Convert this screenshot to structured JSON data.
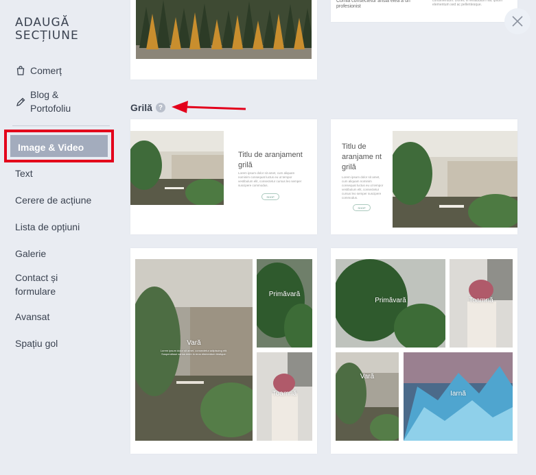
{
  "sidebar": {
    "title": "ADAUGĂ SECȚIUNE",
    "items": [
      {
        "label": "Comerț",
        "icon": "bag-icon"
      },
      {
        "label": "Blog & Portofoliu",
        "icon": "edit-icon"
      },
      {
        "label": "Image & Video"
      },
      {
        "label": "Text"
      },
      {
        "label": "Cerere de acțiune"
      },
      {
        "label": "Lista de opțiuni"
      },
      {
        "label": "Galerie"
      },
      {
        "label": "Contact și formulare"
      },
      {
        "label": "Avansat"
      },
      {
        "label": "Spațiu gol"
      }
    ]
  },
  "main": {
    "top_card_text_left": "Comia consectetur ansia elea a un profesionist",
    "top_card_text_right": "condimentum. Donec in vestibulum hac ipsum elementum sed ac pellentesque.",
    "section_label": "Grilă",
    "grid_card_1": {
      "title": "Titlu de aranjament grilă",
      "body": "Lorem ipsum dolor sit amet, cum aliquam nominim consequat luctus eu ut tempor vestibulum elit, consectetur cursus leo semper suscipere commodus.",
      "button": "SHOP"
    },
    "grid_card_2": {
      "title": "Titlu de aranjame nt grilă",
      "body": "Lorem ipsum dolor sit amet, cum aliquam nominim consequat luctus eu ut tempor vestibulum elit, consectetur cursus leo semper suscipere commodus.",
      "button": "SHOP"
    },
    "seasons_left": {
      "big": "Vară",
      "big_caption": "Lorem ipsum dolor sit amet, consectetur adipiscing elit. Suspendisse varius enim in eros elementum tristique.",
      "top_right": "Primăvară",
      "bottom_right": "Toamnă"
    },
    "seasons_right": {
      "top_left": "Primăvară",
      "top_right": "Toamnă",
      "bottom_left": "Vară",
      "bottom_right": "Iarnă"
    }
  },
  "colors": {
    "highlight": "#e3001b",
    "active_bg": "#a3acbd",
    "background": "#e9ecf2"
  }
}
